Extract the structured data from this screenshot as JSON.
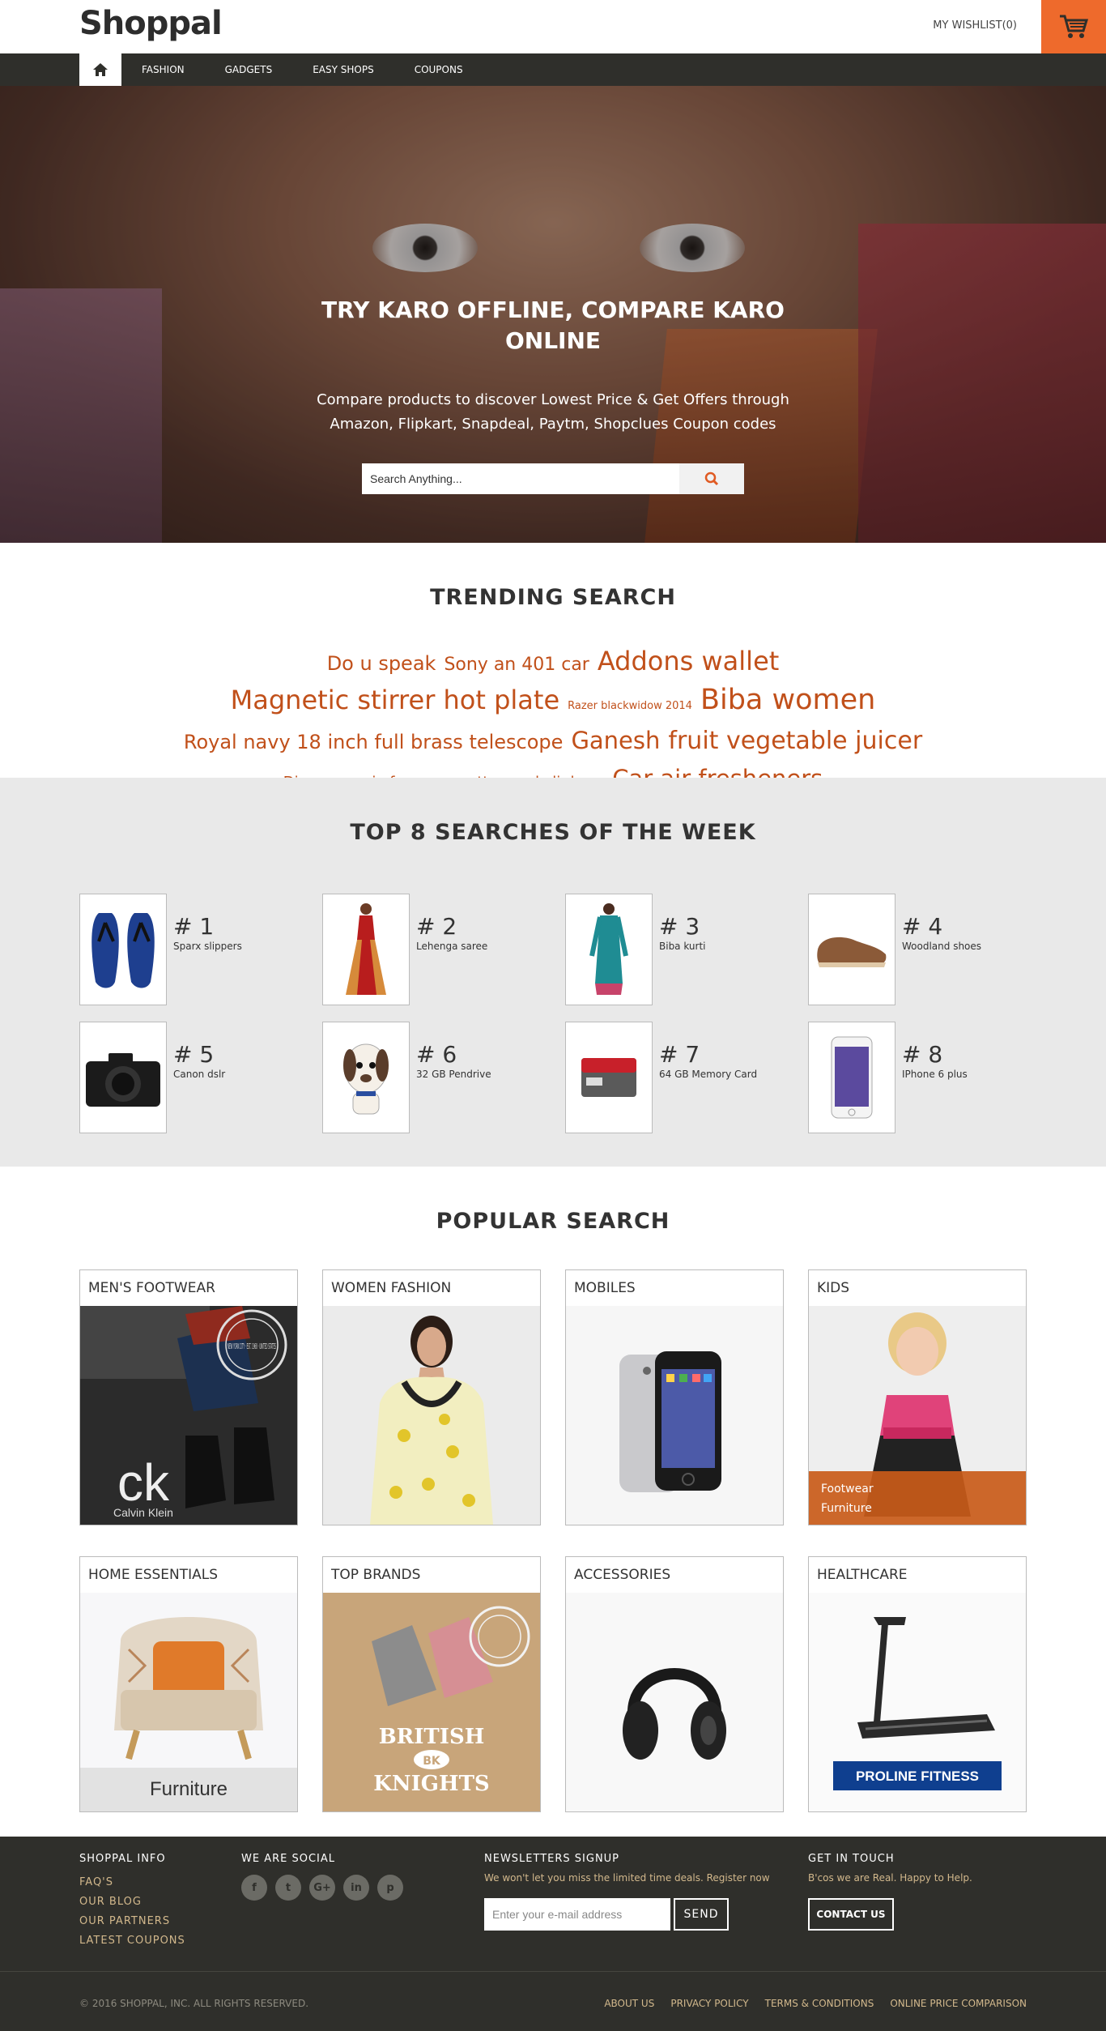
{
  "header": {
    "logo": "Shoppal",
    "wishlist": "MY WISHLIST(0)"
  },
  "nav": {
    "items": [
      "FASHION",
      "GADGETS",
      "EASY SHOPS",
      "COUPONS"
    ]
  },
  "hero": {
    "title": "TRY KARO OFFLINE, COMPARE KARO ONLINE",
    "subtitle": "Compare products to discover Lowest Price & Get Offers through Amazon, Flipkart, Snapdeal, Paytm, Shopclues Coupon codes",
    "search_placeholder": "Search Anything..."
  },
  "trending": {
    "title": "TRENDING SEARCH",
    "tags": [
      {
        "text": "Do u speak",
        "size": 24
      },
      {
        "text": "Sony an 401 car",
        "size": 22
      },
      {
        "text": "Addons wallet",
        "size": 32
      },
      {
        "text": "Magnetic stirrer hot plate",
        "size": 32
      },
      {
        "text": "Razer blackwidow 2014",
        "size": 13
      },
      {
        "text": "Biba women",
        "size": 35
      },
      {
        "text": "Royal navy 18 inch full brass telescope",
        "size": 24
      },
      {
        "text": "Ganesh",
        "size": 29
      },
      {
        "text": "fruit vegetable juicer",
        "size": 30
      },
      {
        "text": "Divyaemporio faux georgette anarkali dress",
        "size": 18
      },
      {
        "text": "Car air fresheners",
        "size": 29
      }
    ]
  },
  "top8": {
    "title": "TOP 8 SEARCHES OF THE WEEK",
    "items": [
      {
        "rank": "# 1",
        "name": "Sparx slippers"
      },
      {
        "rank": "# 2",
        "name": "Lehenga saree"
      },
      {
        "rank": "# 3",
        "name": "Biba kurti"
      },
      {
        "rank": "# 4",
        "name": "Woodland shoes"
      },
      {
        "rank": "# 5",
        "name": "Canon dslr"
      },
      {
        "rank": "# 6",
        "name": "32 GB Pendrive"
      },
      {
        "rank": "# 7",
        "name": "64 GB Memory Card"
      },
      {
        "rank": "# 8",
        "name": "IPhone 6 plus"
      }
    ]
  },
  "popular": {
    "title": "POPULAR SEARCH",
    "cards": [
      {
        "title": "MEN'S FOOTWEAR",
        "brand": "ck",
        "brand_sub": "Calvin Klein",
        "stamp": "NEW YORK CITY · EST. 1968 · UNITED STATES"
      },
      {
        "title": "WOMEN FASHION"
      },
      {
        "title": "MOBILES"
      },
      {
        "title": "KIDS",
        "links": [
          "Footwear",
          "Furniture"
        ]
      },
      {
        "title": "HOME ESSENTIALS",
        "label": "Furniture"
      },
      {
        "title": "TOP BRANDS",
        "brand_line1": "BRITISH",
        "brand_badge": "BK",
        "brand_line2": "KNIGHTS"
      },
      {
        "title": "ACCESSORIES"
      },
      {
        "title": "HEALTHCARE",
        "banner": "PROLINE FITNESS"
      }
    ]
  },
  "footer": {
    "info_title": "SHOPPAL INFO",
    "info_links": [
      "FAQ'S",
      "OUR BLOG",
      "OUR PARTNERS",
      "LATEST COUPONS"
    ],
    "social_title": "WE ARE SOCIAL",
    "social_icons": [
      "f",
      "t",
      "G+",
      "in",
      "p"
    ],
    "newsletter_title": "NEWSLETTERS SIGNUP",
    "newsletter_text": "We won't let you miss the limited time deals. Register now",
    "newsletter_placeholder": "Enter your e-mail address",
    "newsletter_button": "SEND",
    "contact_title": "GET IN TOUCH",
    "contact_text": "B'cos we are Real. Happy to Help.",
    "contact_button": "CONTACT US",
    "copyright": "© 2016 SHOPPAL, INC. ALL RIGHTS RESERVED.",
    "bottom_links": [
      "ABOUT US",
      "PRIVACY POLICY",
      "TERMS & CONDITIONS",
      "ONLINE PRICE COMPARISON"
    ]
  },
  "colors": {
    "accent": "#ee6a2c",
    "dark": "#2f2f2b",
    "tag": "#c1501a"
  }
}
